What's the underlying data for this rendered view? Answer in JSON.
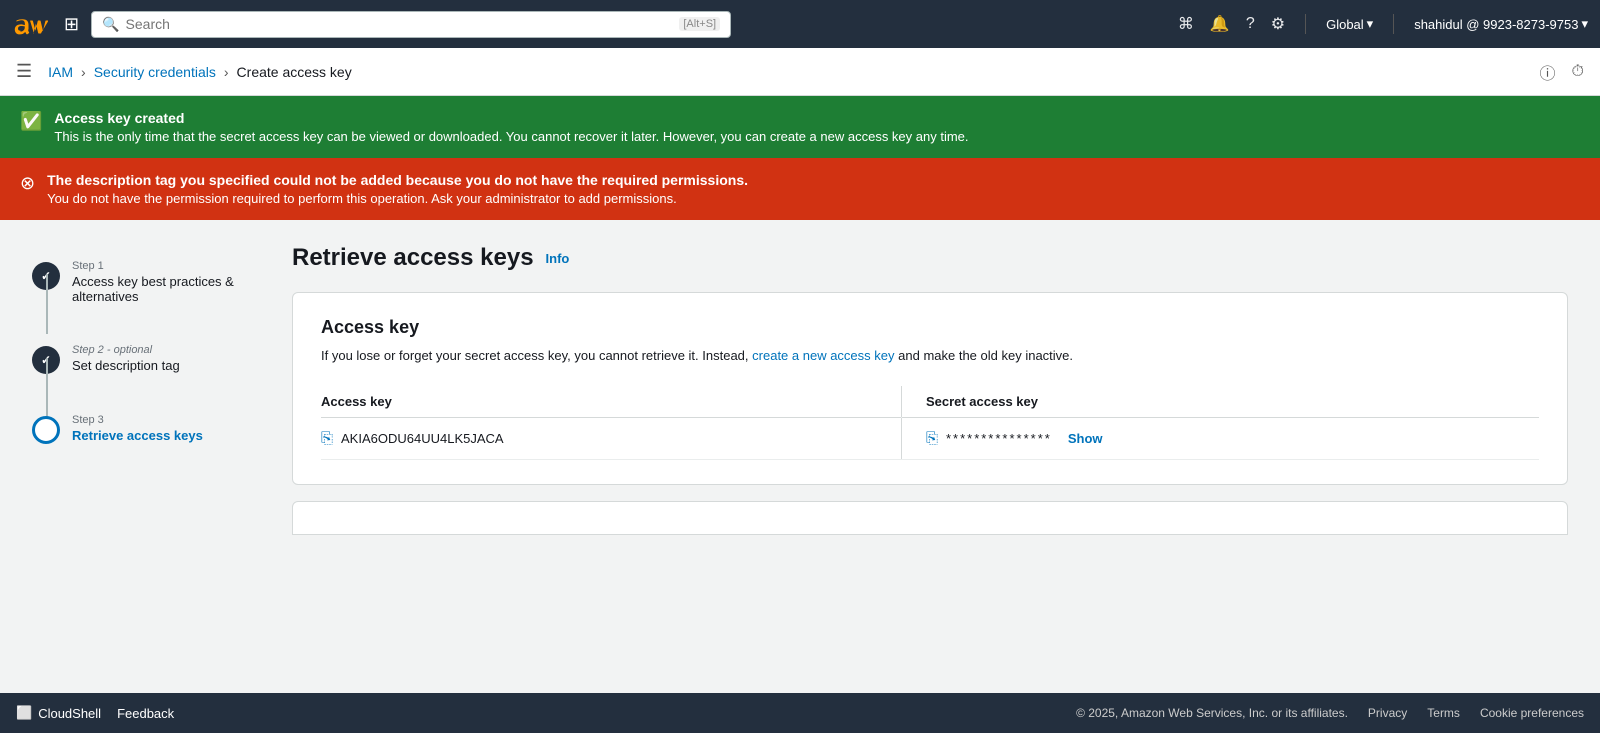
{
  "topnav": {
    "search_placeholder": "Search",
    "search_shortcut": "[Alt+S]",
    "region": "Global",
    "user": "shahidul @ 9923-8273-9753"
  },
  "breadcrumb": {
    "iam": "IAM",
    "security_credentials": "Security credentials",
    "current": "Create access key"
  },
  "alerts": {
    "green": {
      "title": "Access key created",
      "desc": "This is the only time that the secret access key can be viewed or downloaded. You cannot recover it later. However, you can create a new access key any time."
    },
    "red": {
      "title": "The description tag you specified could not be added because you do not have the required permissions.",
      "desc": "You do not have the permission required to perform this operation. Ask your administrator to add permissions."
    }
  },
  "stepper": {
    "steps": [
      {
        "label": "Step 1",
        "title": "Access key best practices & alternatives",
        "state": "completed"
      },
      {
        "label": "Step 2 - optional",
        "title": "Set description tag",
        "state": "completed"
      },
      {
        "label": "Step 3",
        "title": "Retrieve access keys",
        "state": "active"
      }
    ]
  },
  "main": {
    "page_title": "Retrieve access keys",
    "info_link": "Info",
    "card": {
      "title": "Access key",
      "desc_prefix": "If you lose or forget your secret access key, you cannot retrieve it. Instead,",
      "desc_link": "create a new access key",
      "desc_suffix": "and make the old key inactive.",
      "col_access_key": "Access key",
      "col_secret_key": "Secret access key",
      "access_key_value": "AKIA6ODU64UU4LK5JACA",
      "secret_key_masked": "***************",
      "show_label": "Show"
    }
  },
  "footer": {
    "cloudshell_label": "CloudShell",
    "feedback_label": "Feedback",
    "copyright": "© 2025, Amazon Web Services, Inc. or its affiliates.",
    "privacy": "Privacy",
    "terms": "Terms",
    "cookie": "Cookie preferences"
  }
}
